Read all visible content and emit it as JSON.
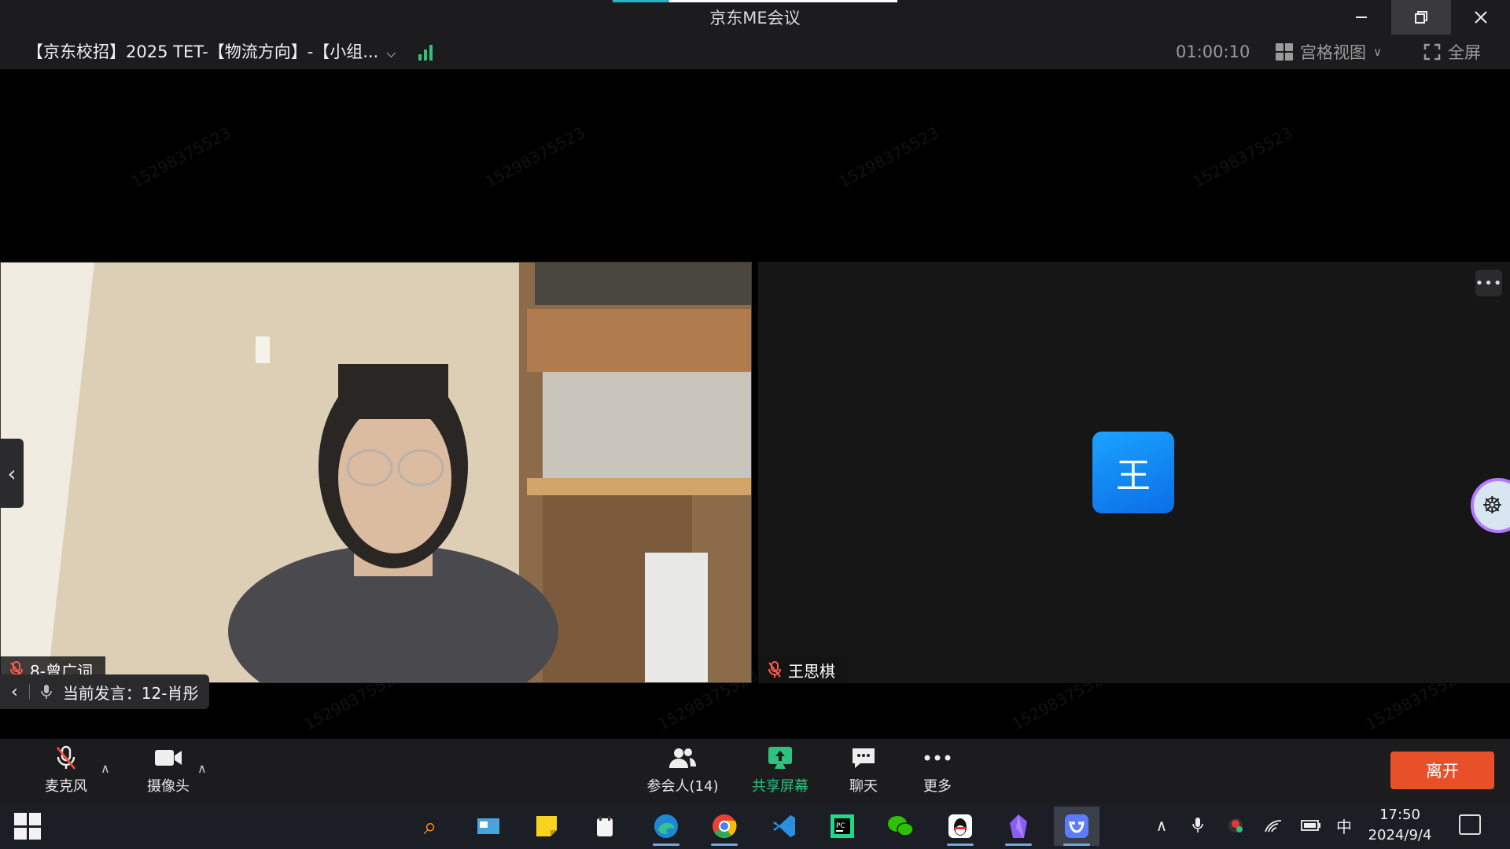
{
  "window": {
    "app_title": "京东ME会议",
    "min_icon": "minimize-icon",
    "restore_icon": "restore-icon",
    "close_icon": "close-icon"
  },
  "meeting": {
    "name": "【京东校招】2025 TET-【物流方向】-【小组...",
    "timer": "01:00:10",
    "view_mode": "宫格视图",
    "fullscreen": "全屏"
  },
  "participants": [
    {
      "name": "8-曾广词",
      "muted": true,
      "video": true
    },
    {
      "name": "王思棋",
      "muted": true,
      "video": false,
      "avatar_letter": "王"
    }
  ],
  "speaker": {
    "label": "当前发言：12-肖彤"
  },
  "watermark": "15298375523",
  "toolbar": {
    "mic_label": "麦克风",
    "camera_label": "摄像头",
    "participants_label": "参会人(14)",
    "share_label": "共享屏幕",
    "chat_label": "聊天",
    "more_label": "更多",
    "leave_label": "离开"
  },
  "taskbar": {
    "ime": "中",
    "time": "17:50",
    "date": "2024/9/4",
    "apps": [
      "search-app",
      "control-panel-app",
      "sticky-notes-app",
      "notepad-app",
      "edge-app",
      "chrome-app",
      "vscode-app",
      "pycharm-app",
      "wechat-app",
      "qq-app",
      "obsidian-app",
      "jd-me-app"
    ]
  },
  "colors": {
    "accent_green": "#2ec27e",
    "leave_red": "#e8502a",
    "avatar_blue": "#1aa3ff",
    "bar_bg": "#1c1c1e"
  }
}
